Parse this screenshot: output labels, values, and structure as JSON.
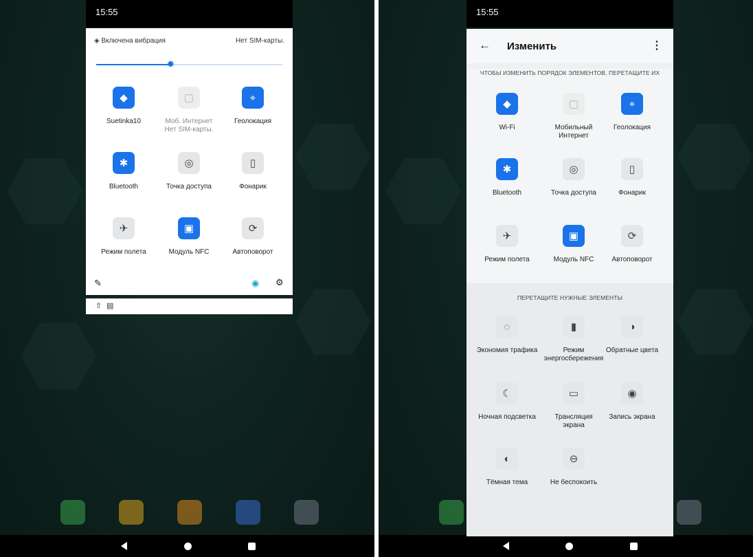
{
  "left_screen": {
    "status_time": "15:55",
    "quick_settings": {
      "vibration_label": "Включена вибрация",
      "sim_status": "Нет SIM-карты.",
      "brightness_level": 0.4,
      "tiles": [
        {
          "label": "Suetinka10",
          "icon": "wifi-icon",
          "state": "on",
          "glyph": "◆"
        },
        {
          "label": "Моб. Интернет",
          "sublabel": "Нет SIM-карты.",
          "icon": "mobile-data-icon",
          "state": "dim",
          "glyph": "▢"
        },
        {
          "label": "Геолокация",
          "icon": "location-icon",
          "state": "on",
          "glyph": "⌖"
        },
        {
          "label": "Bluetooth",
          "icon": "bluetooth-icon",
          "state": "on",
          "glyph": "✱"
        },
        {
          "label": "Точка доступа",
          "icon": "hotspot-icon",
          "state": "off",
          "glyph": "◎"
        },
        {
          "label": "Фонарик",
          "icon": "flashlight-icon",
          "state": "off",
          "glyph": "▯"
        },
        {
          "label": "Режим полета",
          "icon": "airplane-icon",
          "state": "off",
          "glyph": "✈"
        },
        {
          "label": "Модуль NFC",
          "icon": "nfc-icon",
          "state": "on",
          "glyph": "▣"
        },
        {
          "label": "Автоповорот",
          "icon": "autorotate-icon",
          "state": "off",
          "glyph": "⟳"
        }
      ]
    }
  },
  "right_screen": {
    "status_time": "15:55",
    "edit": {
      "title": "Изменить",
      "reorder_hint": "ЧТОБЫ ИЗМЕНИТЬ ПОРЯДОК ЭЛЕМЕНТОВ, ПЕРЕТАЩИТЕ ИХ",
      "drag_hint": "ПЕРЕТАЩИТЕ НУЖНЫЕ ЭЛЕМЕНТЫ",
      "active_tiles": [
        {
          "label": "Wi-Fi",
          "icon": "wifi-icon",
          "state": "on",
          "glyph": "◆"
        },
        {
          "label": "Мобильный",
          "sublabel": "Интернет",
          "icon": "mobile-data-icon",
          "state": "dim",
          "glyph": "▢"
        },
        {
          "label": "Геолокация",
          "icon": "location-icon",
          "state": "on",
          "glyph": "⌖"
        },
        {
          "label": "Bluetooth",
          "icon": "bluetooth-icon",
          "state": "on",
          "glyph": "✱"
        },
        {
          "label": "Точка доступа",
          "icon": "hotspot-icon",
          "state": "off",
          "glyph": "◎"
        },
        {
          "label": "Фонарик",
          "icon": "flashlight-icon",
          "state": "off",
          "glyph": "▯"
        },
        {
          "label": "Режим полета",
          "icon": "airplane-icon",
          "state": "off",
          "glyph": "✈"
        },
        {
          "label": "Модуль NFC",
          "icon": "nfc-icon",
          "state": "on",
          "glyph": "▣"
        },
        {
          "label": "Автоповорот",
          "icon": "autorotate-icon",
          "state": "off",
          "glyph": "⟳"
        }
      ],
      "available_tiles": [
        {
          "label": "Экономия трафика",
          "icon": "data-saver-icon",
          "state": "off",
          "glyph": "◌"
        },
        {
          "label": "Режим",
          "sublabel": "энергосбережения",
          "icon": "battery-saver-icon",
          "state": "off",
          "glyph": "▮"
        },
        {
          "label": "Обратные цвета",
          "icon": "invert-colors-icon",
          "state": "off",
          "glyph": "◑"
        },
        {
          "label": "Ночная подсветка",
          "icon": "night-light-icon",
          "state": "off",
          "glyph": "☾"
        },
        {
          "label": "Трансляция",
          "sublabel": "экрана",
          "icon": "cast-icon",
          "state": "off",
          "glyph": "▭"
        },
        {
          "label": "Запись экрана",
          "icon": "screen-record-icon",
          "state": "off",
          "glyph": "◉"
        },
        {
          "label": "Тёмная тема",
          "icon": "dark-theme-icon",
          "state": "off",
          "glyph": "◐"
        },
        {
          "label": "Не беспокоить",
          "icon": "do-not-disturb-icon",
          "state": "off",
          "glyph": "⊖"
        }
      ]
    }
  },
  "colors": {
    "accent": "#1a73e8",
    "panel": "#ffffff",
    "background": "#0f2420"
  }
}
